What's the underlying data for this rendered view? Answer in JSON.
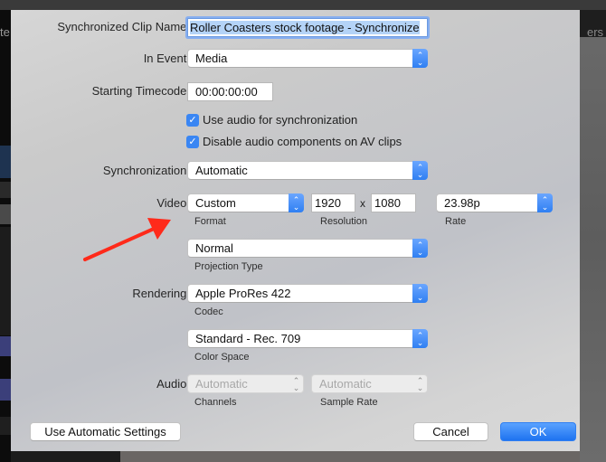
{
  "background": {
    "left_text": "te",
    "right_text": "ers"
  },
  "dialog": {
    "clip_name": {
      "label": "Synchronized Clip Name:",
      "value": "Roller Coasters stock footage - Synchronize"
    },
    "in_event": {
      "label": "In Event:",
      "value": "Media"
    },
    "starting_timecode": {
      "label": "Starting Timecode:",
      "value": "00:00:00:00"
    },
    "checkboxes": [
      {
        "label": "Use audio for synchronization",
        "checked": true
      },
      {
        "label": "Disable audio components on AV clips",
        "checked": true
      }
    ],
    "synchronization": {
      "label": "Synchronization:",
      "value": "Automatic"
    },
    "video": {
      "label": "Video:",
      "format": {
        "value": "Custom",
        "caption": "Format"
      },
      "resolution": {
        "width": "1920",
        "separator": "x",
        "height": "1080",
        "caption": "Resolution"
      },
      "rate": {
        "value": "23.98p",
        "caption": "Rate"
      },
      "projection": {
        "value": "Normal",
        "caption": "Projection Type"
      }
    },
    "rendering": {
      "label": "Rendering:",
      "codec": {
        "value": "Apple ProRes 422",
        "caption": "Codec"
      },
      "color_space": {
        "value": "Standard - Rec. 709",
        "caption": "Color Space"
      }
    },
    "audio": {
      "label": "Audio:",
      "channels": {
        "value": "Automatic",
        "caption": "Channels",
        "disabled": true
      },
      "sample_rate": {
        "value": "Automatic",
        "caption": "Sample Rate",
        "disabled": true
      }
    },
    "buttons": {
      "auto_settings": "Use Automatic Settings",
      "cancel": "Cancel",
      "ok": "OK"
    },
    "icons": {
      "checkmark": "✓",
      "chevron_up": "⌃",
      "chevron_down": "⌄",
      "annotation_arrow": "red-arrow"
    }
  },
  "colors": {
    "accent": "#2f7ff2",
    "annotation": "#ff2a1a"
  }
}
